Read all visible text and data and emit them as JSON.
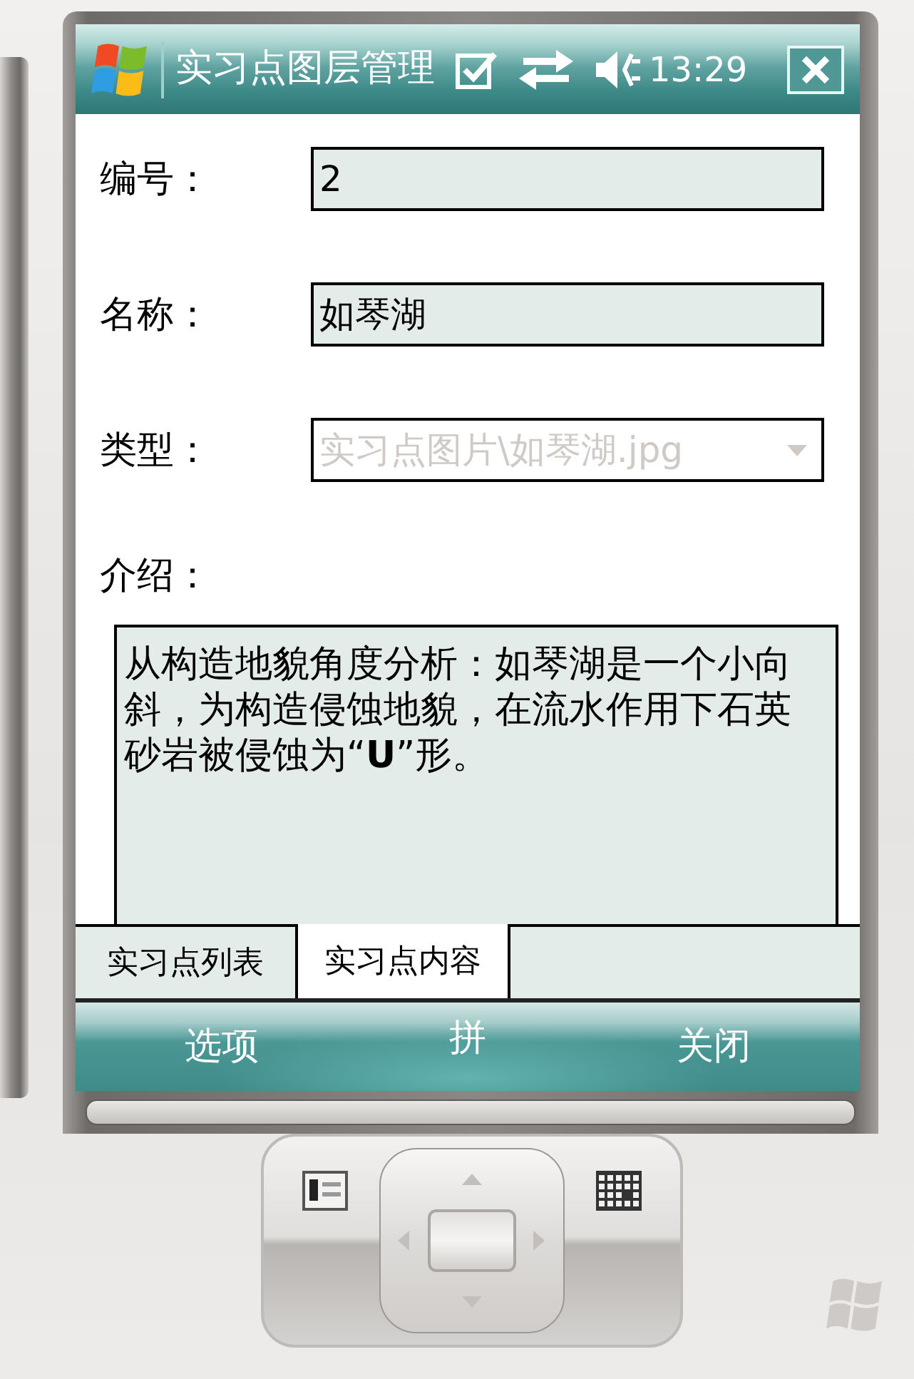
{
  "title_bar": {
    "title": "实习点图层管理",
    "time": "13:29"
  },
  "form": {
    "fields": [
      {
        "kind": "text",
        "label": "编号：",
        "value": "2",
        "disabled": false
      },
      {
        "kind": "text",
        "label": "名称：",
        "value": "如琴湖",
        "disabled": false
      },
      {
        "kind": "dropdown",
        "label": "类型：",
        "value": "实习点图片\\如琴湖.jpg",
        "disabled": true
      },
      {
        "kind": "textarea",
        "label": "介绍：",
        "value": "从构造地貌角度分析：如琴湖是一个小向斜，为构造侵蚀地貌，在流水作用下石英砂岩被侵蚀为“**U**”形。",
        "disabled": false
      }
    ]
  },
  "tabs": [
    {
      "label": "实习点列表",
      "selected": false
    },
    {
      "label": "实习点内容",
      "selected": true
    }
  ],
  "soft_keys": {
    "left": "选项",
    "input_method": "拼",
    "right": "关闭"
  }
}
